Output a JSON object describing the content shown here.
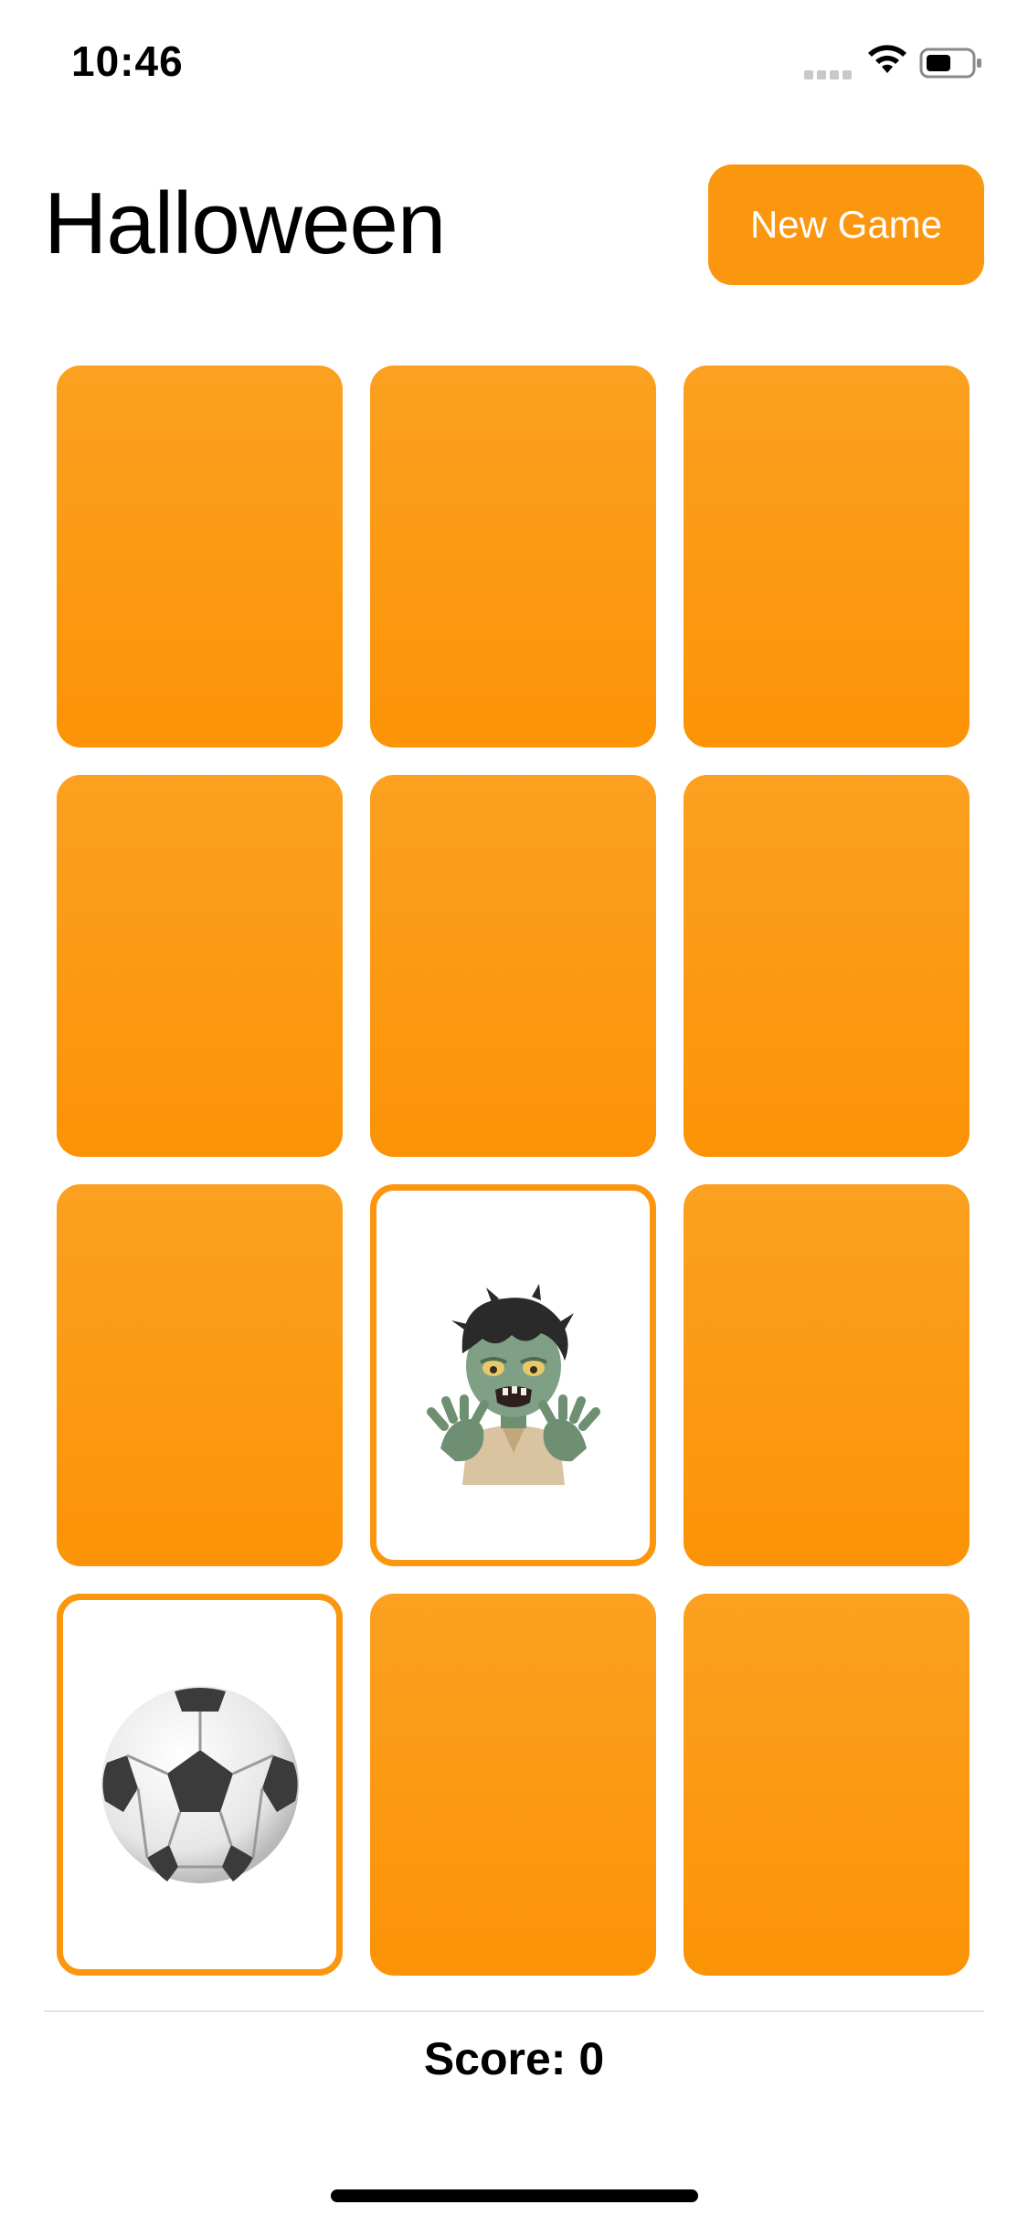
{
  "status_bar": {
    "time": "10:46",
    "icons": [
      "signal-icon",
      "wifi-icon",
      "battery-icon"
    ]
  },
  "header": {
    "title": "Halloween",
    "new_game_label": "New Game"
  },
  "theme": {
    "accent": "#fb960f",
    "card_back_top": "#fba020",
    "card_back_bottom": "#fc9306",
    "card_face_bg": "#ffffff"
  },
  "cards": [
    {
      "state": "face-down",
      "content": ""
    },
    {
      "state": "face-down",
      "content": ""
    },
    {
      "state": "face-down",
      "content": ""
    },
    {
      "state": "face-down",
      "content": ""
    },
    {
      "state": "face-down",
      "content": ""
    },
    {
      "state": "face-down",
      "content": ""
    },
    {
      "state": "face-down",
      "content": ""
    },
    {
      "state": "face-up",
      "content": "zombie-emoji"
    },
    {
      "state": "face-down",
      "content": ""
    },
    {
      "state": "face-up",
      "content": "soccer-ball-emoji"
    },
    {
      "state": "face-down",
      "content": ""
    },
    {
      "state": "face-down",
      "content": ""
    }
  ],
  "footer": {
    "score_text": "Score: 0"
  }
}
